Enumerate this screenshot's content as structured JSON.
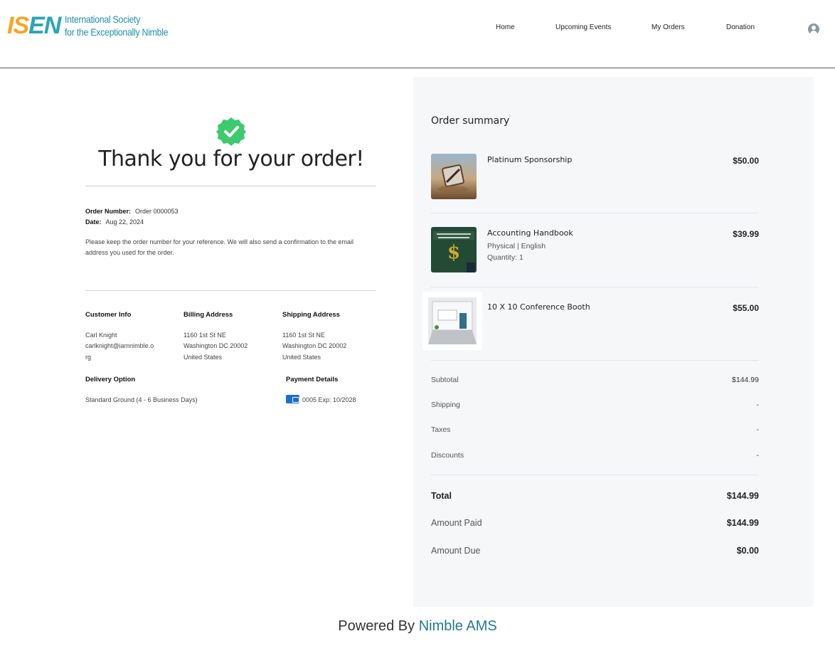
{
  "header": {
    "logo_mark_part1": "IS",
    "logo_mark_part2": "EN",
    "logo_line1": "International Society",
    "logo_line2": "for the Exceptionally Nimble",
    "nav": [
      "Home",
      "Upcoming Events",
      "My Orders",
      "Donation"
    ]
  },
  "confirmation": {
    "title": "Thank you for your order!",
    "order_number_label": "Order Number:",
    "order_number": "Order 0000053",
    "date_label": "Date:",
    "date": "Aug 22, 2024",
    "note": "Please keep the order number for your reference. We will also send a confirmation to the email address you used for the order."
  },
  "customer": {
    "label": "Customer Info",
    "name": "Carl Knight",
    "email_line1": "carlknight@iamnimble.o",
    "email_line2": "rg"
  },
  "billing": {
    "label": "Billing Address",
    "street": "1160 1st St NE",
    "city": "Washington DC 20002",
    "country": "United States"
  },
  "shipping_address": {
    "label": "Shipping Address",
    "street": "1160 1st St NE",
    "city": "Washington DC 20002",
    "country": "United States"
  },
  "delivery": {
    "label": "Delivery Option",
    "value": "Standard Ground (4 - 6 Business Days)"
  },
  "payment": {
    "label": "Payment Details",
    "value": "0005 Exp: 10/2028"
  },
  "summary": {
    "title": "Order summary",
    "items": [
      {
        "name": "Platinum Sponsorship",
        "price": "$50.00"
      },
      {
        "name": "Accounting Handbook",
        "sub1": "Physical | English",
        "sub2": "Quantity: 1",
        "price": "$39.99"
      },
      {
        "name": "10 X 10 Conference Booth",
        "price": "$55.00"
      }
    ],
    "subtotal_label": "Subtotal",
    "subtotal": "$144.99",
    "shipping_label": "Shipping",
    "shipping": "-",
    "taxes_label": "Taxes",
    "taxes": "-",
    "discounts_label": "Discounts",
    "discounts": "-",
    "total_label": "Total",
    "total": "$144.99",
    "paid_label": "Amount Paid",
    "paid": "$144.99",
    "due_label": "Amount Due",
    "due": "$0.00"
  },
  "footer": {
    "prefix": "Powered By",
    "brand": "Nimble AMS"
  },
  "colors": {
    "accent": "#227a8a",
    "success": "#3ec96f",
    "panel": "#f6f7f9"
  }
}
